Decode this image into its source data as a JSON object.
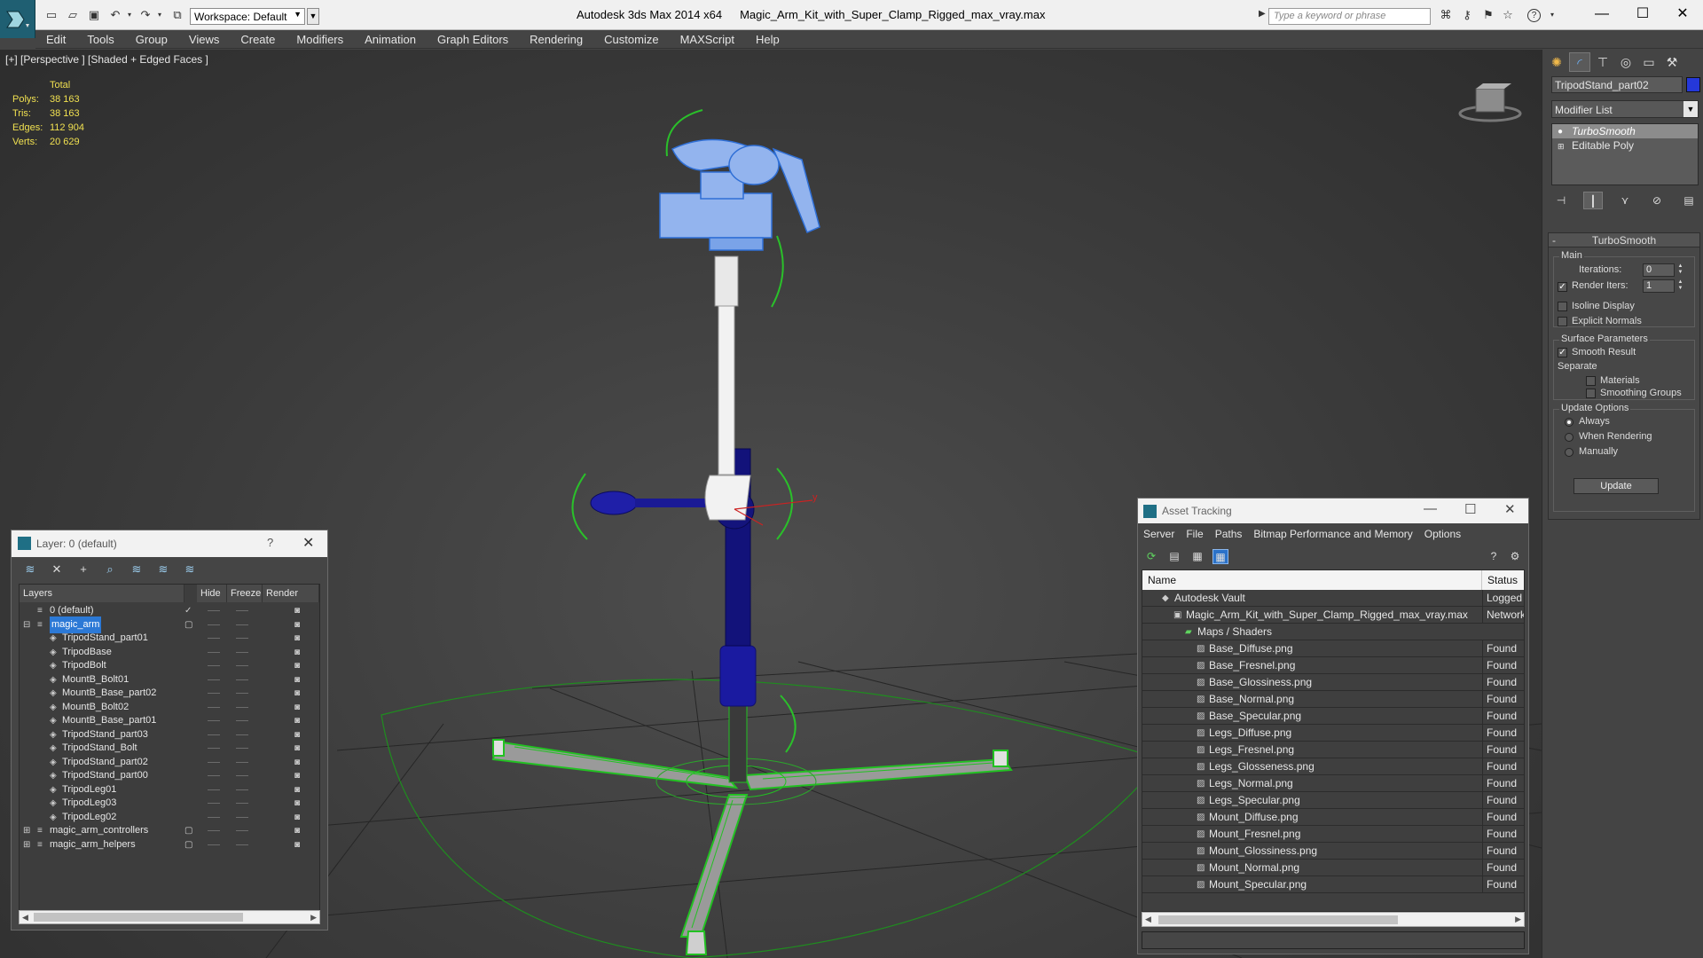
{
  "titlebar": {
    "workspace": "Workspace: Default",
    "app_name": "Autodesk 3ds Max  2014 x64",
    "file_name": "Magic_Arm_Kit_with_Super_Clamp_Rigged_max_vray.max",
    "search_placeholder": "Type a keyword or phrase"
  },
  "menu": [
    "Edit",
    "Tools",
    "Group",
    "Views",
    "Create",
    "Modifiers",
    "Animation",
    "Graph Editors",
    "Rendering",
    "Customize",
    "MAXScript",
    "Help"
  ],
  "viewport": {
    "label": "[+] [Perspective ] [Shaded + Edged Faces ]",
    "stats": {
      "total_label": "Total",
      "rows": [
        {
          "label": "Polys:",
          "value": "38 163"
        },
        {
          "label": "Tris:",
          "value": "38 163"
        },
        {
          "label": "Edges:",
          "value": "112 904"
        },
        {
          "label": "Verts:",
          "value": "20 629"
        }
      ]
    },
    "gizmo_axis": "y"
  },
  "command_panel": {
    "object_name": "TripodStand_part02",
    "object_color": "#2538d9",
    "modifier_list": "Modifier List",
    "stack": [
      "TurboSmooth",
      "Editable Poly"
    ],
    "rollout": {
      "title": "TurboSmooth",
      "main_group": "Main",
      "iterations_label": "Iterations:",
      "iterations_value": "0",
      "render_iters_label": "Render Iters:",
      "render_iters_value": "1",
      "render_iters_checked": true,
      "isoline_label": "Isoline Display",
      "explicit_normals_label": "Explicit Normals",
      "surface_group": "Surface Parameters",
      "smooth_result_label": "Smooth Result",
      "separate_label": "Separate",
      "materials_label": "Materials",
      "smoothing_groups_label": "Smoothing Groups",
      "update_group": "Update Options",
      "always_label": "Always",
      "when_rendering_label": "When Rendering",
      "manually_label": "Manually",
      "update_button": "Update"
    }
  },
  "layer_window": {
    "title": "Layer: 0 (default)",
    "help": "?",
    "columns": [
      "Layers",
      "Hide",
      "Freeze",
      "Render"
    ],
    "rows": [
      {
        "name": "0 (default)",
        "level": 0,
        "type": "layer",
        "check": true
      },
      {
        "name": "magic_arm",
        "level": 0,
        "type": "layer",
        "selected": true,
        "box": true,
        "expanded": true
      },
      {
        "name": "TripodStand_part01",
        "level": 1,
        "type": "object"
      },
      {
        "name": "TripodBase",
        "level": 1,
        "type": "object"
      },
      {
        "name": "TripodBolt",
        "level": 1,
        "type": "object"
      },
      {
        "name": "MountB_Bolt01",
        "level": 1,
        "type": "object"
      },
      {
        "name": "MountB_Base_part02",
        "level": 1,
        "type": "object"
      },
      {
        "name": "MountB_Bolt02",
        "level": 1,
        "type": "object"
      },
      {
        "name": "MountB_Base_part01",
        "level": 1,
        "type": "object"
      },
      {
        "name": "TripodStand_part03",
        "level": 1,
        "type": "object"
      },
      {
        "name": "TripodStand_Bolt",
        "level": 1,
        "type": "object"
      },
      {
        "name": "TripodStand_part02",
        "level": 1,
        "type": "object"
      },
      {
        "name": "TripodStand_part00",
        "level": 1,
        "type": "object"
      },
      {
        "name": "TripodLeg01",
        "level": 1,
        "type": "object"
      },
      {
        "name": "TripodLeg03",
        "level": 1,
        "type": "object"
      },
      {
        "name": "TripodLeg02",
        "level": 1,
        "type": "object"
      },
      {
        "name": "magic_arm_controllers",
        "level": 0,
        "type": "layer",
        "box": true,
        "expandable": true
      },
      {
        "name": "magic_arm_helpers",
        "level": 0,
        "type": "layer",
        "box": true,
        "expandable": true
      }
    ]
  },
  "asset_window": {
    "title": "Asset Tracking",
    "menu": [
      "Server",
      "File",
      "Paths",
      "Bitmap Performance and Memory",
      "Options"
    ],
    "columns": [
      "Name",
      "Status"
    ],
    "rows": [
      {
        "name": "Autodesk Vault",
        "level": 0,
        "status": "Logged Out"
      },
      {
        "name": "Magic_Arm_Kit_with_Super_Clamp_Rigged_max_vray.max",
        "level": 1,
        "status": "Network"
      },
      {
        "name": "Maps / Shaders",
        "level": 2,
        "status": ""
      },
      {
        "name": "Base_Diffuse.png",
        "level": 3,
        "status": "Found"
      },
      {
        "name": "Base_Fresnel.png",
        "level": 3,
        "status": "Found"
      },
      {
        "name": "Base_Glossiness.png",
        "level": 3,
        "status": "Found"
      },
      {
        "name": "Base_Normal.png",
        "level": 3,
        "status": "Found"
      },
      {
        "name": "Base_Specular.png",
        "level": 3,
        "status": "Found"
      },
      {
        "name": "Legs_Diffuse.png",
        "level": 3,
        "status": "Found"
      },
      {
        "name": "Legs_Fresnel.png",
        "level": 3,
        "status": "Found"
      },
      {
        "name": "Legs_Glosseness.png",
        "level": 3,
        "status": "Found"
      },
      {
        "name": "Legs_Normal.png",
        "level": 3,
        "status": "Found"
      },
      {
        "name": "Legs_Specular.png",
        "level": 3,
        "status": "Found"
      },
      {
        "name": "Mount_Diffuse.png",
        "level": 3,
        "status": "Found"
      },
      {
        "name": "Mount_Fresnel.png",
        "level": 3,
        "status": "Found"
      },
      {
        "name": "Mount_Glossiness.png",
        "level": 3,
        "status": "Found"
      },
      {
        "name": "Mount_Normal.png",
        "level": 3,
        "status": "Found"
      },
      {
        "name": "Mount_Specular.png",
        "level": 3,
        "status": "Found"
      }
    ]
  }
}
